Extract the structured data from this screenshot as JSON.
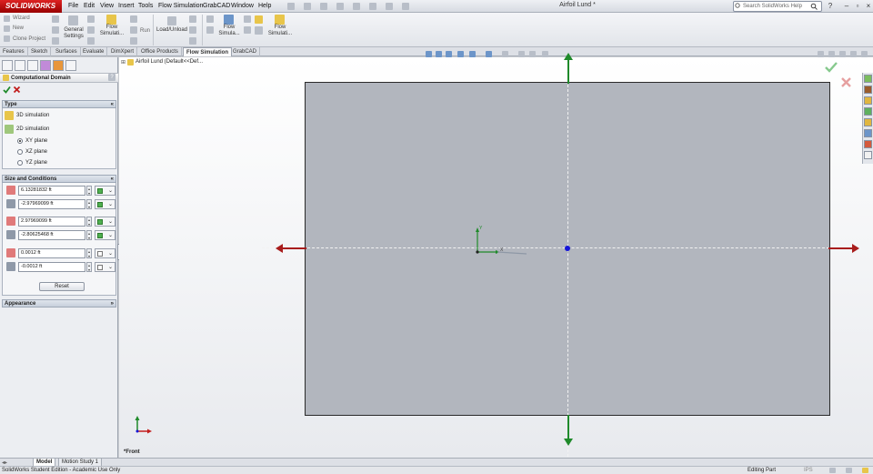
{
  "app": {
    "logo": "SOLIDWORKS",
    "title": "Airfoil Lund *",
    "menu": [
      "File",
      "Edit",
      "View",
      "Insert",
      "Tools",
      "Flow Simulation",
      "GrabCAD",
      "Window",
      "Help"
    ],
    "search_placeholder": "Search SolidWorks Help"
  },
  "ribbon": {
    "wizard": "Wizard",
    "new": "New",
    "clone_project": "Clone Project",
    "general_settings": "General Settings",
    "flow_simulation_1": "Flow Simulati...",
    "run": "Run",
    "load_unload": "Load/Unload",
    "flow_simulation_2": "Flow Simula...",
    "flow_simulation_3": "Flow Simulati..."
  },
  "command_tabs": [
    "Features",
    "Sketch",
    "Surfaces",
    "Evaluate",
    "DimXpert",
    "Office Products",
    "Flow Simulation",
    "GrabCAD"
  ],
  "active_tab": "Flow Simulation",
  "tree": {
    "root_label": "Airfoil Lund  (Default<<Def..."
  },
  "property_manager": {
    "title": "Computational Domain",
    "type": {
      "header": "Type",
      "options": [
        "3D simulation",
        "2D simulation"
      ],
      "planes": [
        "XY plane",
        "XZ plane",
        "YZ plane"
      ],
      "selected_plane": "XY plane"
    },
    "size": {
      "header": "Size and Conditions",
      "fields": [
        "6.13281832 ft",
        "-2.97969099 ft",
        "2.97969099 ft",
        "-2.80625468 ft",
        "0.0012 ft",
        "-0.0012 ft"
      ],
      "reset": "Reset"
    },
    "appearance": {
      "header": "Appearance"
    }
  },
  "view": {
    "name": "*Front"
  },
  "bottom_tabs": [
    "Model",
    "Motion Study 1"
  ],
  "status": {
    "left": "SolidWorks Student Edition - Academic Use Only",
    "mode": "Editing Part",
    "units": "IPS"
  },
  "colors": {
    "arrow_red": "#a81c1c",
    "arrow_green": "#1f8a2a",
    "origin_blue": "#1515d8",
    "domain_fill": "#b2b6be"
  }
}
